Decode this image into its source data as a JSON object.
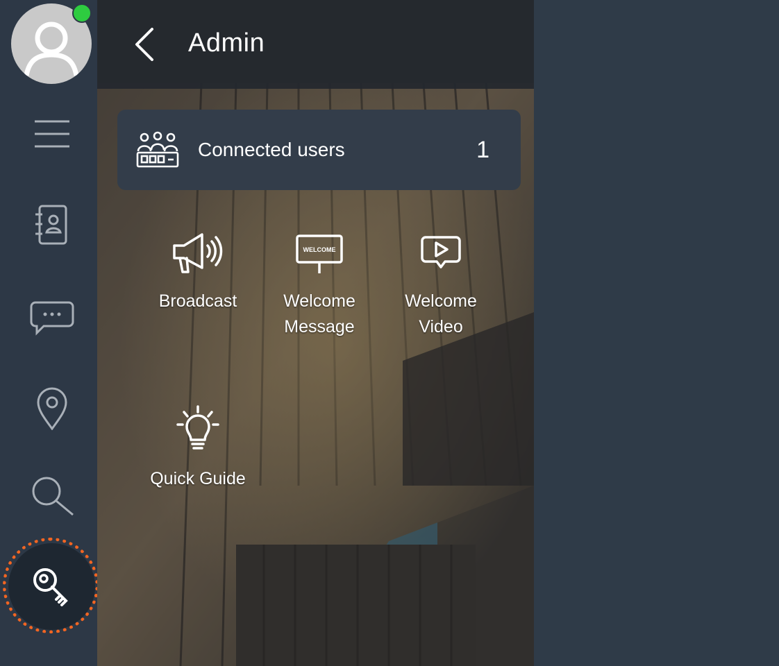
{
  "panel": {
    "title": "Admin",
    "connected_users": {
      "label": "Connected users",
      "count": "1"
    },
    "tiles": [
      {
        "label": "Broadcast",
        "icon": "megaphone-icon"
      },
      {
        "label": "Welcome Message",
        "icon": "welcome-sign-icon",
        "sign_text": "WELCOME"
      },
      {
        "label": "Welcome Video",
        "icon": "video-bubble-icon"
      },
      {
        "label": "Quick Guide",
        "icon": "lightbulb-icon"
      }
    ]
  },
  "rail": {
    "items": [
      {
        "icon": "menu-icon"
      },
      {
        "icon": "contacts-book-icon"
      },
      {
        "icon": "chat-bubble-icon"
      },
      {
        "icon": "location-pin-icon"
      },
      {
        "icon": "search-icon"
      },
      {
        "icon": "key-icon",
        "active": true
      }
    ],
    "status": "online"
  },
  "colors": {
    "rail_bg": "#2d3846",
    "page_bg": "#2f3b48",
    "card_bg": "#333d4a",
    "online_dot": "#2ecc40",
    "active_ring": "#f26522",
    "active_button_bg": "#1e2731"
  }
}
